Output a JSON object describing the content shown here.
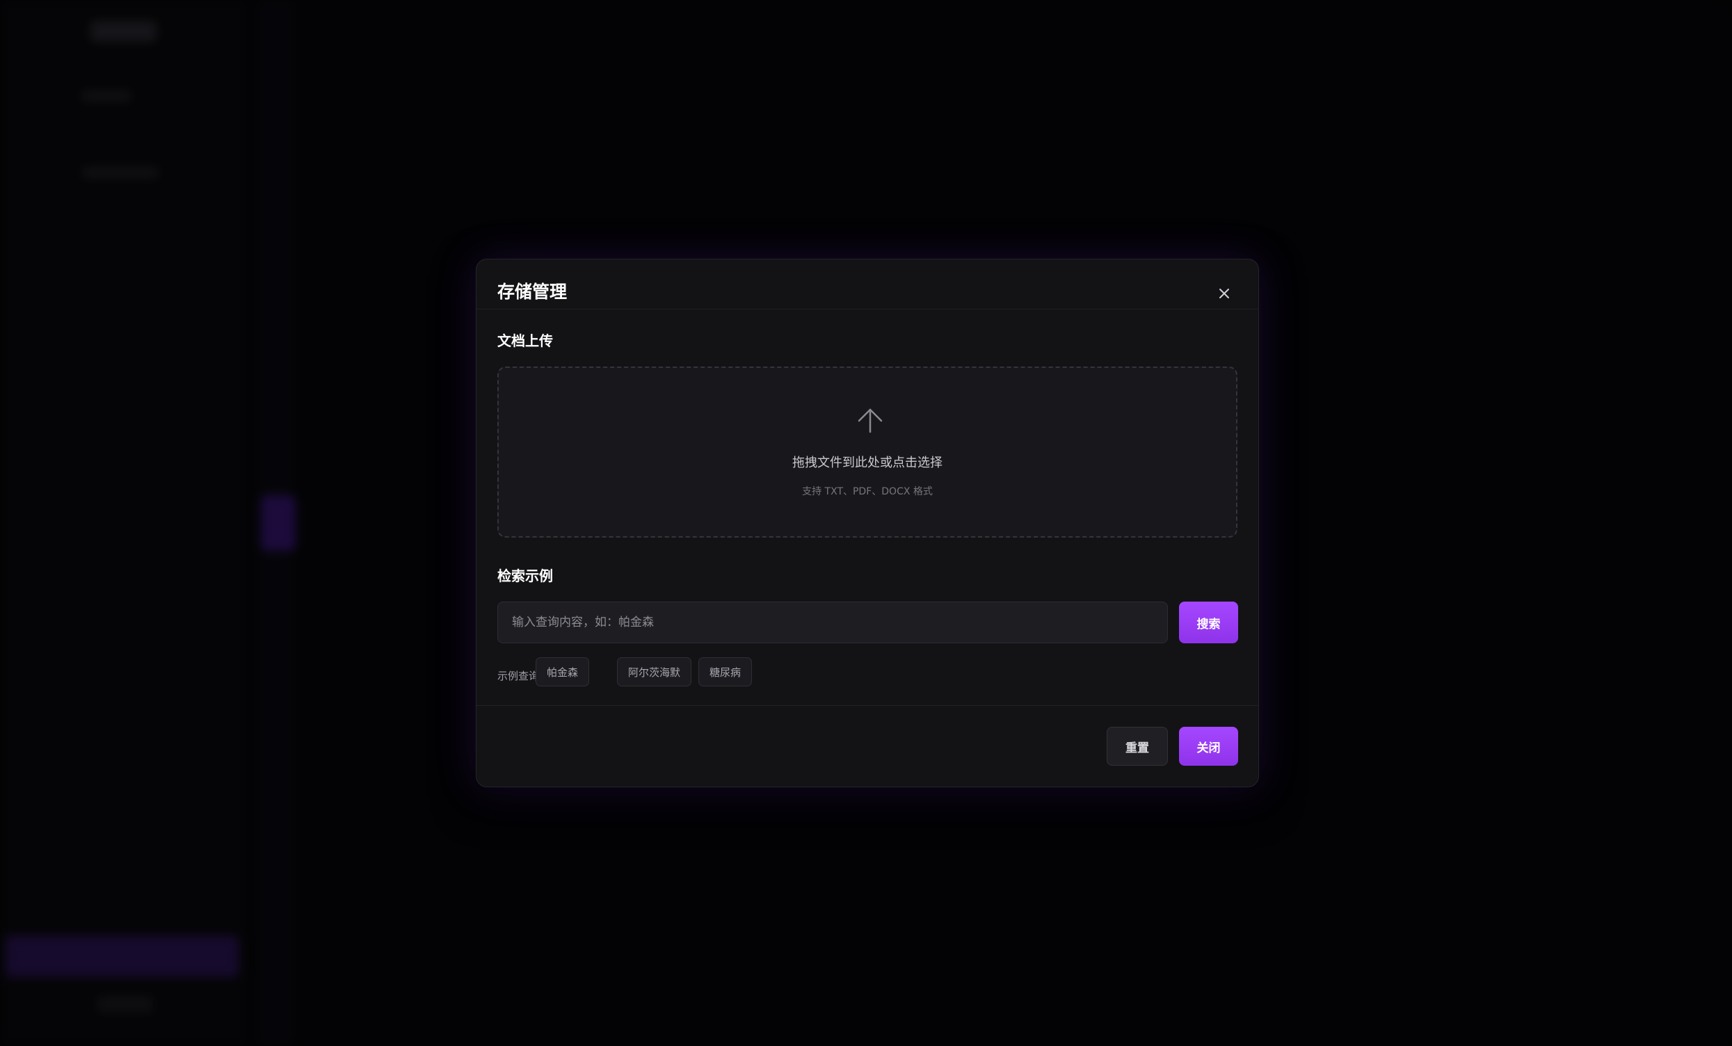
{
  "modal": {
    "title": "存储管理",
    "close_icon": "close-icon"
  },
  "upload": {
    "section_title": "文档上传",
    "icon": "upload-arrow-icon",
    "drop_text": "拖拽文件到此处或点击选择",
    "hint": "支持 TXT、PDF、DOCX 格式"
  },
  "search": {
    "section_title": "检索示例",
    "placeholder": "输入查询内容，如：帕金森",
    "value": "",
    "button_label": "搜索",
    "examples_label": "示例查询:",
    "examples": [
      "帕金森",
      "阿尔茨海默",
      "糖尿病"
    ]
  },
  "footer": {
    "reset_label": "重置",
    "close_label": "关闭"
  },
  "colors": {
    "accent": "#9a3cf2",
    "modal_bg": "#131316",
    "page_bg": "#050507"
  }
}
